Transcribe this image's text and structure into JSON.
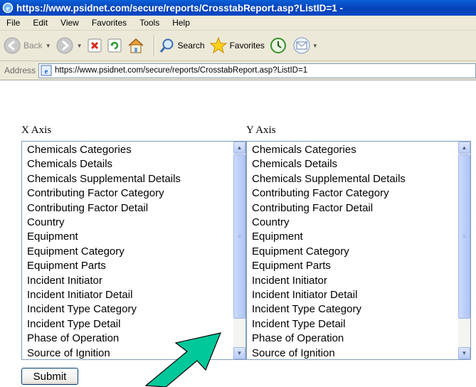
{
  "window": {
    "title": "https://www.psidnet.com/secure/reports/CrosstabReport.asp?ListID=1 -"
  },
  "menu": [
    "File",
    "Edit",
    "View",
    "Favorites",
    "Tools",
    "Help"
  ],
  "toolbar": {
    "back": "Back",
    "search": "Search",
    "favorites": "Favorites"
  },
  "address": {
    "label": "Address",
    "url": "https://www.psidnet.com/secure/reports/CrosstabReport.asp?ListID=1"
  },
  "form": {
    "x_label": "X Axis",
    "y_label": "Y Axis",
    "x_options": [
      "Chemicals Categories",
      "Chemicals Details",
      "Chemicals Supplemental Details",
      "Contributing Factor Category",
      "Contributing Factor Detail",
      "Country",
      "Equipment",
      "Equipment Category",
      "Equipment Parts",
      "Incident Initiator",
      "Incident Initiator Detail",
      "Incident Type Category",
      "Incident Type Detail",
      "Phase of Operation",
      "Source of Ignition"
    ],
    "y_options": [
      "Chemicals Categories",
      "Chemicals Details",
      "Chemicals Supplemental Details",
      "Contributing Factor Category",
      "Contributing Factor Detail",
      "Country",
      "Equipment",
      "Equipment Category",
      "Equipment Parts",
      "Incident Initiator",
      "Incident Initiator Detail",
      "Incident Type Category",
      "Incident Type Detail",
      "Phase of Operation",
      "Source of Ignition"
    ],
    "submit": "Submit"
  },
  "colors": {
    "titlebar": "#0a4fd0",
    "chrome": "#ece9d8",
    "scrollbar": "#bccff8",
    "annotation_arrow": "#00c89a"
  }
}
